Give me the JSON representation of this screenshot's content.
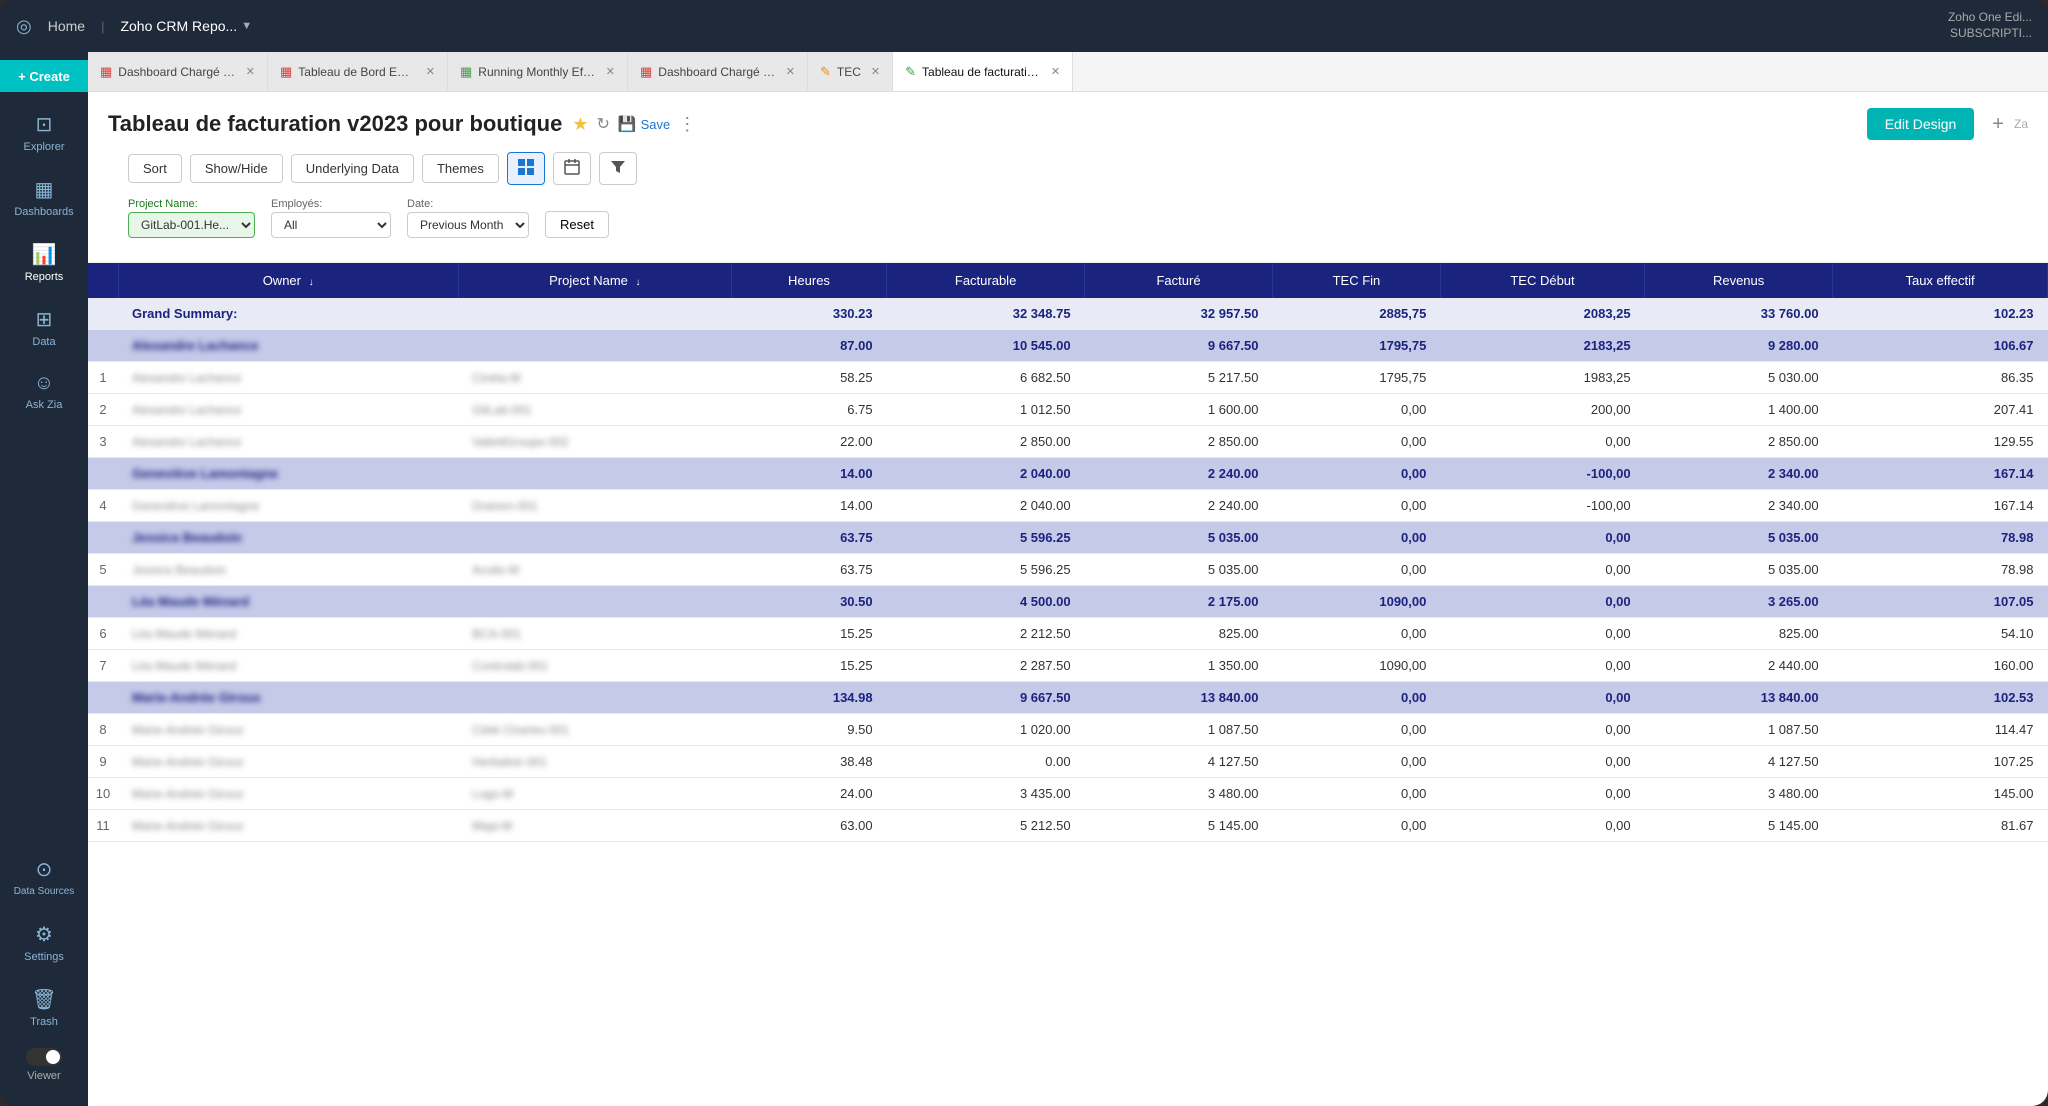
{
  "app": {
    "logo": "◎",
    "home": "Home",
    "app_name": "Zoho CRM Repo...",
    "top_right": "Zoho One Edi...\nSUBSCRIPTI..."
  },
  "tabs": [
    {
      "id": "tab1",
      "icon": "▦",
      "label": "Dashboard Chargé d...",
      "closable": true,
      "active": false,
      "icon_color": "#e53935"
    },
    {
      "id": "tab2",
      "icon": "▦",
      "label": "Tableau de Bord Emp...",
      "closable": true,
      "active": false,
      "icon_color": "#e53935"
    },
    {
      "id": "tab3",
      "icon": "▦",
      "label": "Running Monthly Eff...",
      "closable": true,
      "active": false,
      "icon_color": "#43a047"
    },
    {
      "id": "tab4",
      "icon": "▦",
      "label": "Dashboard Chargé w...",
      "closable": true,
      "active": false,
      "icon_color": "#e53935"
    },
    {
      "id": "tab5",
      "icon": "✎",
      "label": "TEC",
      "closable": true,
      "active": false,
      "icon_color": "#fb8c00"
    },
    {
      "id": "tab6",
      "icon": "✎",
      "label": "Tableau de facturation...",
      "closable": true,
      "active": true,
      "icon_color": "#43a047"
    }
  ],
  "create_btn": "+ Create",
  "sidebar": {
    "items": [
      {
        "id": "explorer",
        "icon": "◉",
        "label": "Explorer",
        "active": false
      },
      {
        "id": "dashboards",
        "icon": "▦",
        "label": "Dashboards",
        "active": false
      },
      {
        "id": "reports",
        "icon": "▐",
        "label": "Reports",
        "active": true
      },
      {
        "id": "data",
        "icon": "⊞",
        "label": "Data",
        "active": false
      },
      {
        "id": "ask-zia",
        "icon": "☺",
        "label": "Ask Zia",
        "active": false
      }
    ],
    "bottom": [
      {
        "id": "data-sources",
        "icon": "⊙",
        "label": "Data Sources",
        "active": false
      },
      {
        "id": "settings",
        "icon": "⚙",
        "label": "Settings",
        "active": false
      },
      {
        "id": "trash",
        "icon": "🗑",
        "label": "Trash",
        "active": false
      }
    ],
    "viewer_label": "Viewer",
    "viewer_on": false
  },
  "report": {
    "title": "Tableau de facturation v2023 pour boutique",
    "edit_design_label": "Edit Design",
    "save_label": "Save",
    "toolbar": {
      "sort": "Sort",
      "show_hide": "Show/Hide",
      "underlying_data": "Underlying Data",
      "themes": "Themes"
    },
    "filters": {
      "project_name_label": "Project Name:",
      "project_name_value": "GitLab-001.He...",
      "employes_label": "Employés:",
      "employes_value": "All",
      "date_label": "Date:",
      "date_value": "Previous Month",
      "reset_label": "Reset"
    },
    "table": {
      "columns": [
        "Owner",
        "Project Name",
        "Heures",
        "Facturable",
        "Facturé",
        "TEC Fin",
        "TEC Début",
        "Revenus",
        "Taux effectif"
      ],
      "grand_summary": {
        "label": "Grand Summary:",
        "heures": "330.23",
        "facturable": "32 348.75",
        "facture": "32 957.50",
        "tec_fin": "2885,75",
        "tec_debut": "2083,25",
        "revenus": "33 760.00",
        "taux": "102.23"
      },
      "groups": [
        {
          "owner": "Alexandre Lachance",
          "subtotal": {
            "heures": "87.00",
            "facturable": "10 545.00",
            "facture": "9 667.50",
            "tec_fin": "1795,75",
            "tec_debut": "2183,25",
            "revenus": "9 280.00",
            "taux": "106.67"
          },
          "rows": [
            {
              "num": "1",
              "owner": "Alexandre Lachance",
              "project": "Cinéla-M",
              "heures": "58.25",
              "facturable": "6 682.50",
              "facture": "5 217.50",
              "tec_fin": "1795,75",
              "tec_debut": "1983,25",
              "revenus": "5 030.00",
              "taux": "86.35"
            },
            {
              "num": "2",
              "owner": "Alexandre Lachance",
              "project": "GitLab-001",
              "heures": "6.75",
              "facturable": "1 012.50",
              "facture": "1 600.00",
              "tec_fin": "0,00",
              "tec_debut": "200,00",
              "revenus": "1 400.00",
              "taux": "207.41"
            },
            {
              "num": "3",
              "owner": "Alexandre Lachance",
              "project": "VallettGroupe-002",
              "heures": "22.00",
              "facturable": "2 850.00",
              "facture": "2 850.00",
              "tec_fin": "0,00",
              "tec_debut": "0,00",
              "revenus": "2 850.00",
              "taux": "129.55"
            }
          ]
        },
        {
          "owner": "Geneviève Lamontagne",
          "subtotal": {
            "heures": "14.00",
            "facturable": "2 040.00",
            "facture": "2 240.00",
            "tec_fin": "0,00",
            "tec_debut": "-100,00",
            "revenus": "2 340.00",
            "taux": "167.14"
          },
          "rows": [
            {
              "num": "4",
              "owner": "Geneviève Lamontagne",
              "project": "Draiven-001",
              "heures": "14.00",
              "facturable": "2 040.00",
              "facture": "2 240.00",
              "tec_fin": "0,00",
              "tec_debut": "-100,00",
              "revenus": "2 340.00",
              "taux": "167.14"
            }
          ]
        },
        {
          "owner": "Jessica Beaudoin",
          "subtotal": {
            "heures": "63.75",
            "facturable": "5 596.25",
            "facture": "5 035.00",
            "tec_fin": "0,00",
            "tec_debut": "0,00",
            "revenus": "5 035.00",
            "taux": "78.98"
          },
          "rows": [
            {
              "num": "5",
              "owner": "Jessica Beaudoin",
              "project": "Acolio-M",
              "heures": "63.75",
              "facturable": "5 596.25",
              "facture": "5 035.00",
              "tec_fin": "0,00",
              "tec_debut": "0,00",
              "revenus": "5 035.00",
              "taux": "78.98"
            }
          ]
        },
        {
          "owner": "Léa Maude Ménard",
          "subtotal": {
            "heures": "30.50",
            "facturable": "4 500.00",
            "facture": "2 175.00",
            "tec_fin": "1090,00",
            "tec_debut": "0,00",
            "revenus": "3 265.00",
            "taux": "107.05"
          },
          "rows": [
            {
              "num": "6",
              "owner": "Léa Maude Ménard",
              "project": "BCA-001",
              "heures": "15.25",
              "facturable": "2 212.50",
              "facture": "825.00",
              "tec_fin": "0,00",
              "tec_debut": "0,00",
              "revenus": "825.00",
              "taux": "54.10"
            },
            {
              "num": "7",
              "owner": "Léa Maude Ménard",
              "project": "Controlab-001",
              "heures": "15.25",
              "facturable": "2 287.50",
              "facture": "1 350.00",
              "tec_fin": "1090,00",
              "tec_debut": "0,00",
              "revenus": "2 440.00",
              "taux": "160.00"
            }
          ]
        },
        {
          "owner": "Marie-Andrée Giroux",
          "subtotal": {
            "heures": "134.98",
            "facturable": "9 667.50",
            "facture": "13 840.00",
            "tec_fin": "0,00",
            "tec_debut": "0,00",
            "revenus": "13 840.00",
            "taux": "102.53"
          },
          "rows": [
            {
              "num": "8",
              "owner": "Marie-Andrée Giroux",
              "project": "Ciété Charles-001",
              "heures": "9.50",
              "facturable": "1 020.00",
              "facture": "1 087.50",
              "tec_fin": "0,00",
              "tec_debut": "0,00",
              "revenus": "1 087.50",
              "taux": "114.47"
            },
            {
              "num": "9",
              "owner": "Marie-Andrée Giroux",
              "project": "Herbalixir-001",
              "heures": "38.48",
              "facturable": "0.00",
              "facture": "4 127.50",
              "tec_fin": "0,00",
              "tec_debut": "0,00",
              "revenus": "4 127.50",
              "taux": "107.25"
            },
            {
              "num": "10",
              "owner": "Marie-Andrée Giroux",
              "project": "Logo-M",
              "heures": "24.00",
              "facturable": "3 435.00",
              "facture": "3 480.00",
              "tec_fin": "0,00",
              "tec_debut": "0,00",
              "revenus": "3 480.00",
              "taux": "145.00"
            },
            {
              "num": "11",
              "owner": "Marie-Andrée Giroux",
              "project": "Mapi-M",
              "heures": "63.00",
              "facturable": "5 212.50",
              "facture": "5 145.00",
              "tec_fin": "0,00",
              "tec_debut": "0,00",
              "revenus": "5 145.00",
              "taux": "81.67"
            }
          ]
        }
      ]
    }
  }
}
